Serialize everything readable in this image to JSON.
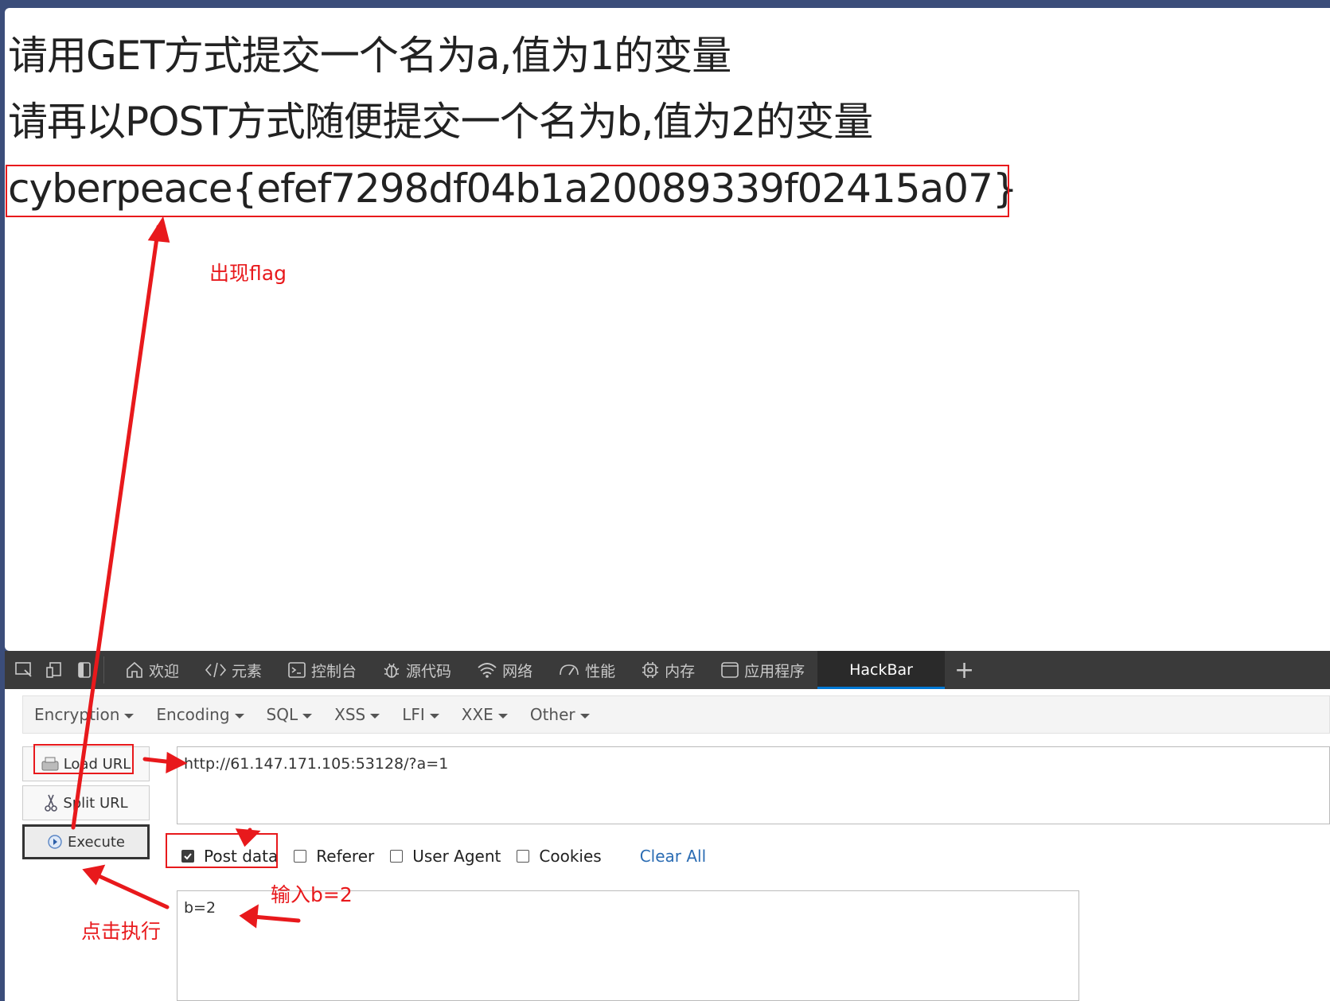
{
  "page": {
    "line1": "请用GET方式提交一个名为a,值为1的变量",
    "line2": "请再以POST方式随便提交一个名为b,值为2的变量",
    "flag": "cyberpeace{efef7298df04b1a20089339f02415a07}"
  },
  "devtools": {
    "tabs": [
      {
        "label": "欢迎",
        "icon": "home-icon"
      },
      {
        "label": "元素",
        "icon": "code-icon"
      },
      {
        "label": "控制台",
        "icon": "console-icon"
      },
      {
        "label": "源代码",
        "icon": "bug-icon"
      },
      {
        "label": "网络",
        "icon": "wifi-icon"
      },
      {
        "label": "性能",
        "icon": "gauge-icon"
      },
      {
        "label": "内存",
        "icon": "chip-icon"
      },
      {
        "label": "应用程序",
        "icon": "app-icon"
      },
      {
        "label": "HackBar",
        "icon": ""
      }
    ],
    "plus": "+"
  },
  "hackbar": {
    "menu": [
      "Encryption",
      "Encoding",
      "SQL",
      "XSS",
      "LFI",
      "XXE",
      "Other"
    ],
    "load_url": "Load URL",
    "split_url": "Split URL",
    "execute": "Execute",
    "url_value": "http://61.147.171.105:53128/?a=1",
    "options": {
      "post_data": "Post data",
      "referer": "Referer",
      "user_agent": "User Agent",
      "cookies": "Cookies",
      "clear_all": "Clear All"
    },
    "post_value": "b=2"
  },
  "annotations": {
    "flag_note": "出现flag",
    "input_note": "输入b=2",
    "click_note": "点击执行",
    "color": "#e8191c"
  }
}
